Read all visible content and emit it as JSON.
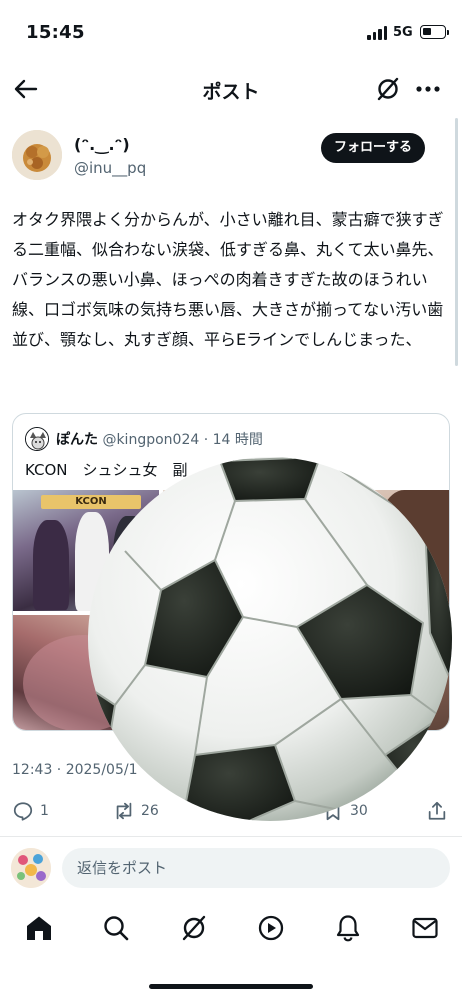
{
  "status_bar": {
    "time": "15:45",
    "network": "5G"
  },
  "header": {
    "title": "ポスト"
  },
  "post": {
    "author": {
      "display_name": "(ᵔ.‿.ᵔ)",
      "handle": "@inu__pq"
    },
    "follow_label": "フォローする",
    "text": "オタク界隈よく分からんが、小さい離れ目、蒙古癖で狭すぎる二重幅、似合わない涙袋、低すぎる鼻、丸くて太い鼻先、バランスの悪い小鼻、ほっぺの肉着きすぎた故のほうれい線、口ゴボ気味の気持ち悪い唇、大きさが揃ってない汚い歯並び、顎なし、丸すぎ顔、平らEラインでしんじまった、",
    "timestamp": "12:43 · 2025/05/1"
  },
  "quoted_post": {
    "name": "ぽんた",
    "handle": "@kingpon024",
    "time": "· 14 時間",
    "text": "KCON　シュシュ女　副",
    "media_banner": "KCON"
  },
  "actions": {
    "replies": "1",
    "reposts": "26",
    "bookmarks": "30"
  },
  "reply_bar": {
    "placeholder": "返信をポスト"
  },
  "icons": {
    "back": "arrow-left-icon",
    "grok": "grok-icon",
    "more": "more-horizontal-icon",
    "reply": "reply-icon",
    "repost": "repost-icon",
    "bookmark": "bookmark-icon",
    "share": "share-icon",
    "tabs": [
      "home-icon",
      "search-icon",
      "grok-icon",
      "video-icon",
      "notifications-icon",
      "messages-icon"
    ],
    "overlay": "soccer-ball-emoji"
  },
  "colors": {
    "text": "#0f1419",
    "secondary": "#536471",
    "button": "#0f1419",
    "input_bg": "#eff3f4",
    "divider": "#e7e9ea"
  }
}
